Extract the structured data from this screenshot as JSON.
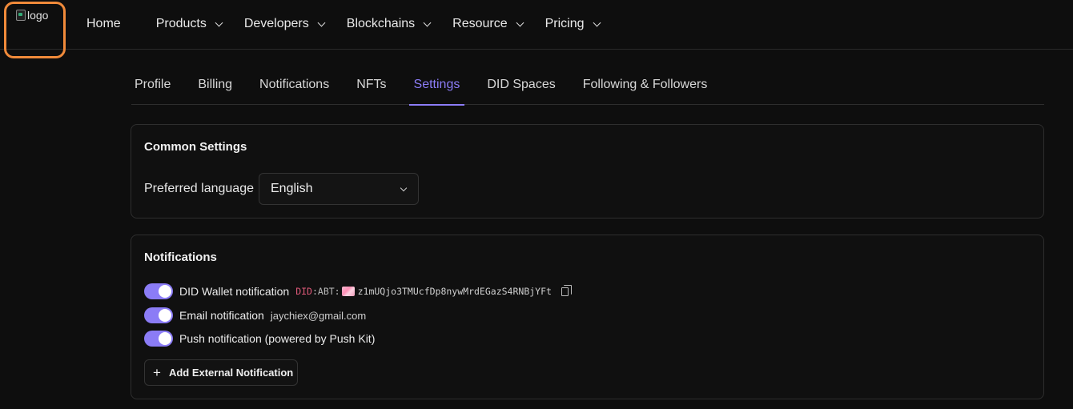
{
  "logo": {
    "alt": "logo"
  },
  "nav": {
    "items": [
      {
        "label": "Home",
        "has_menu": false
      },
      {
        "label": "Products",
        "has_menu": true
      },
      {
        "label": "Developers",
        "has_menu": true
      },
      {
        "label": "Blockchains",
        "has_menu": true
      },
      {
        "label": "Resource",
        "has_menu": true
      },
      {
        "label": "Pricing",
        "has_menu": true
      }
    ]
  },
  "tabs": [
    {
      "label": "Profile",
      "active": false
    },
    {
      "label": "Billing",
      "active": false
    },
    {
      "label": "Notifications",
      "active": false
    },
    {
      "label": "NFTs",
      "active": false
    },
    {
      "label": "Settings",
      "active": true
    },
    {
      "label": "DID Spaces",
      "active": false
    },
    {
      "label": "Following & Followers",
      "active": false
    }
  ],
  "common_settings": {
    "title": "Common Settings",
    "language_label": "Preferred language",
    "language_value": "English"
  },
  "notifications": {
    "title": "Notifications",
    "did_wallet": {
      "label": "DID Wallet notification",
      "enabled": true,
      "did_prefix": "DID",
      "did_method": ":ABT:",
      "did_address": "z1mUQjo3TMUcfDp8nywMrdEGazS4RNBjYFt"
    },
    "email": {
      "label": "Email notification",
      "enabled": true,
      "address": "jaychiex@gmail.com"
    },
    "push": {
      "label": "Push notification (powered by Push Kit)",
      "enabled": true
    },
    "add_button_label": "Add External Notification"
  },
  "colors": {
    "accent": "#8b7cf6",
    "highlight_outline": "#f08a3a",
    "background": "#0e0e0e",
    "did_prefix": "#e05a7a"
  }
}
